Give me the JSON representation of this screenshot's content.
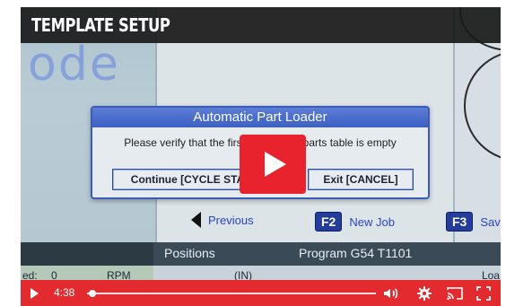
{
  "overlay": {
    "title": "TEMPLATE SETUP"
  },
  "cnc": {
    "big_word": "ode",
    "dialog": {
      "title": "Automatic Part Loader",
      "message": "Please verify that the first position on parts table is empty",
      "continue_label": "Continue [CYCLE START]",
      "exit_label": "Exit [CANCEL]"
    },
    "nav": {
      "previous_label": "Previous",
      "f2_key": "F2",
      "new_job_label": "New Job",
      "f3_key": "F3",
      "f3_label": "Sav"
    },
    "positions_header": "Positions",
    "program_header": "Program G54 T1101",
    "unit": "(IN)",
    "speed_label": "ed:",
    "speed_value": "0",
    "rpm_label": "RPM",
    "load_label": "Loa"
  },
  "controls": {
    "time": "4:38",
    "progress_fraction": 0.02
  },
  "colors": {
    "accent": "#e22a2f",
    "dialog_title": "#3c5fc2"
  }
}
